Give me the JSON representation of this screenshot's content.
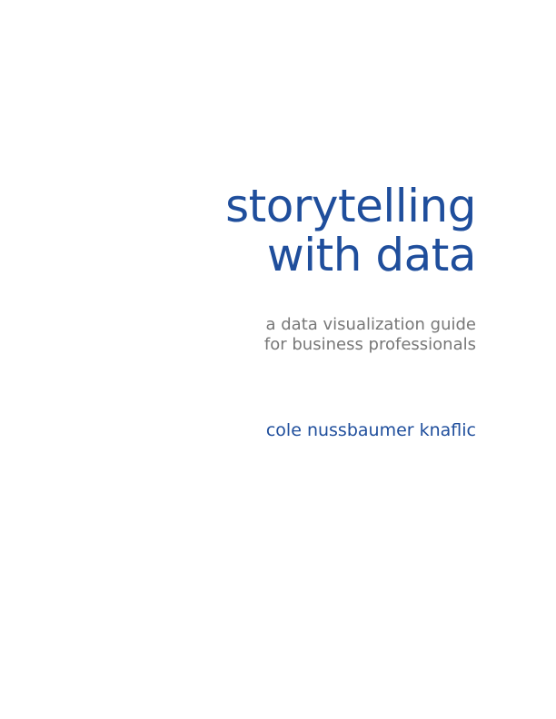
{
  "title": {
    "line1": "storytelling",
    "line2": "with data"
  },
  "subtitle": {
    "line1": "a data visualization guide",
    "line2": "for business professionals"
  },
  "author": "cole nussbaumer knaflic",
  "colors": {
    "title": "#1f4e9c",
    "subtitle": "#777777",
    "author": "#1f4e9c"
  }
}
